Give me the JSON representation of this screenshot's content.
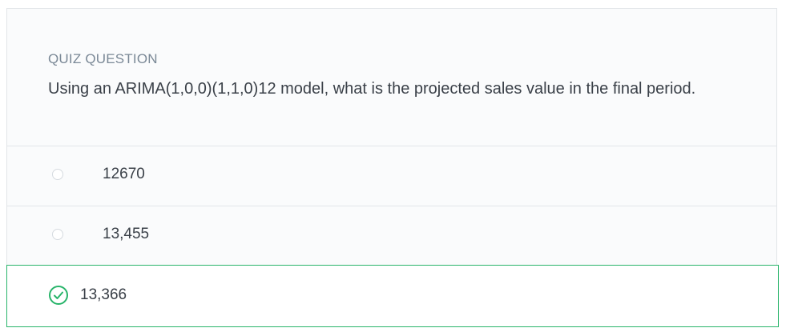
{
  "quiz": {
    "label": "QUIZ QUESTION",
    "question": "Using an ARIMA(1,0,0)(1,1,0)12 model, what is the projected sales value in the final period.",
    "options": [
      {
        "label": "12670",
        "selected": false
      },
      {
        "label": "13,455",
        "selected": false
      },
      {
        "label": "13,366",
        "selected": true,
        "correct": true
      }
    ]
  },
  "colors": {
    "correct_accent": "#28b46a",
    "label_gray": "#7a8896",
    "text": "#3a4048",
    "border": "#e2e5e8"
  },
  "icons": {
    "unselected": "radio-empty-icon",
    "selected_correct": "check-circle-icon"
  }
}
